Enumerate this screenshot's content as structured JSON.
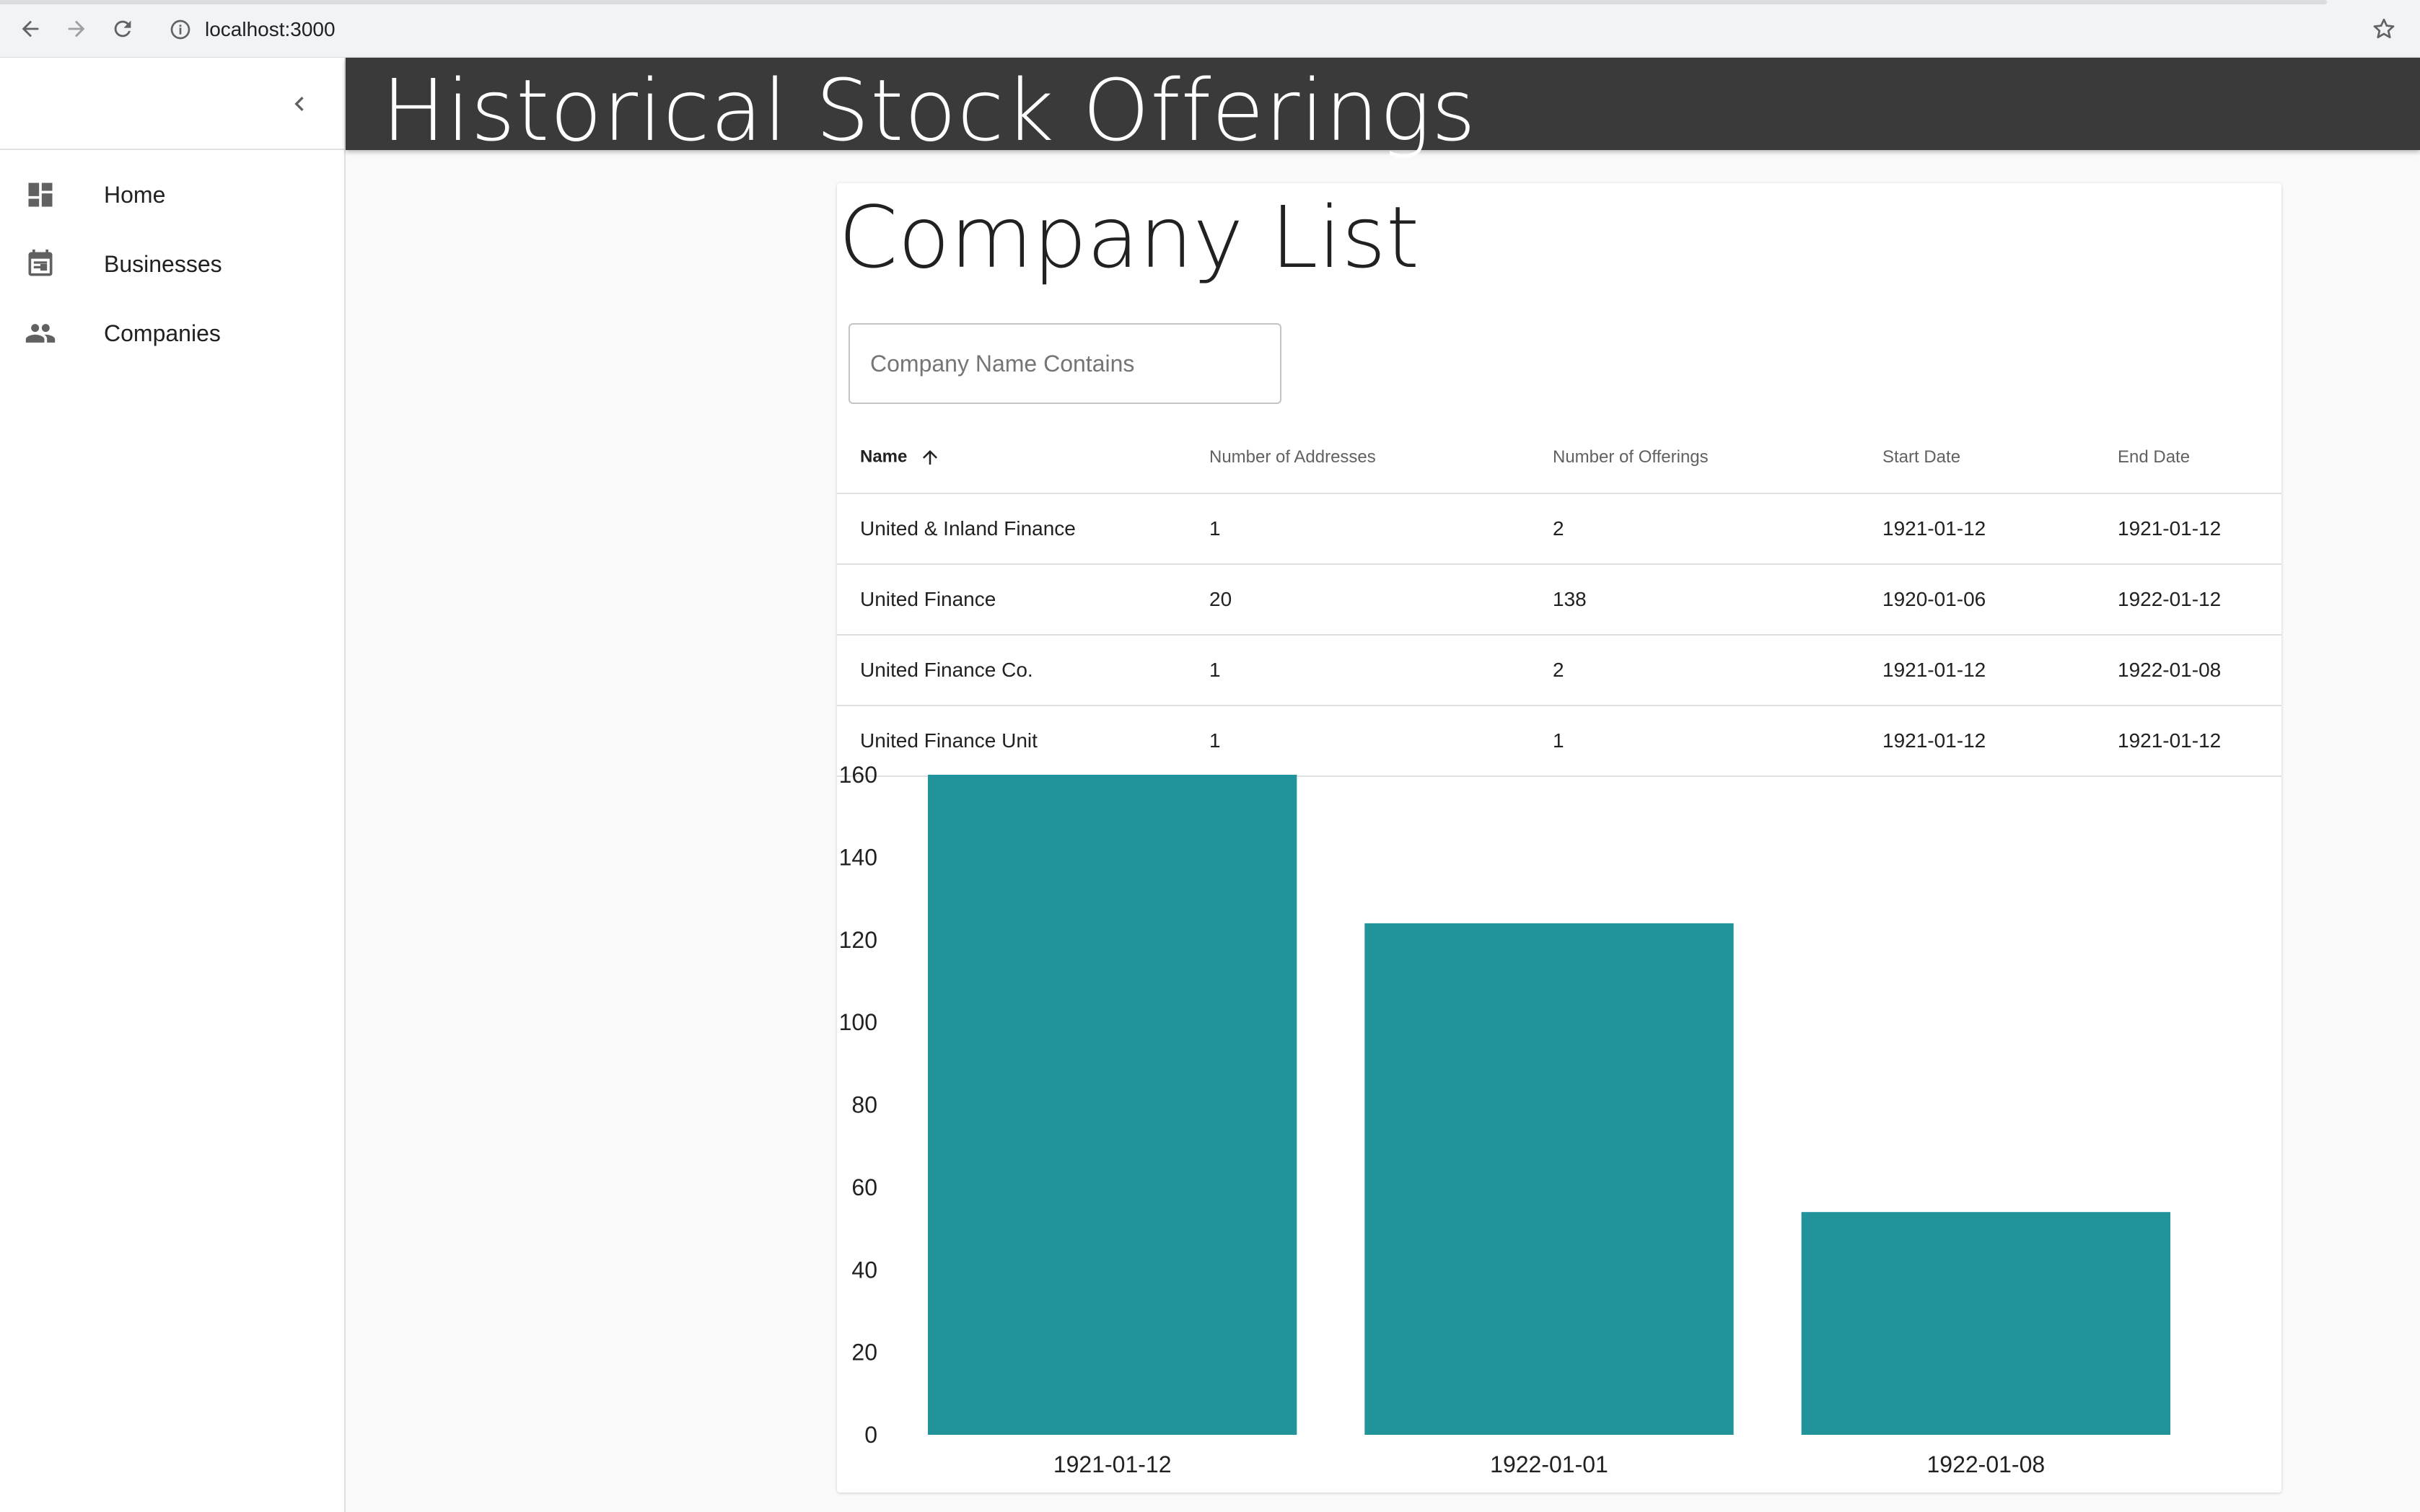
{
  "browser": {
    "url": "localhost:3000",
    "icons": [
      "back-icon",
      "forward-icon",
      "reload-icon",
      "info-icon",
      "star-icon"
    ]
  },
  "sidebar": {
    "items": [
      {
        "label": "Home",
        "icon": "dashboard-icon"
      },
      {
        "label": "Businesses",
        "icon": "calendar-icon"
      },
      {
        "label": "Companies",
        "icon": "people-icon"
      }
    ]
  },
  "header": {
    "title": "Historical Stock Offerings"
  },
  "main": {
    "title": "Company List",
    "search": {
      "placeholder": "Company Name Contains",
      "value": ""
    },
    "table": {
      "sorted_column": "Name",
      "sort_direction": "ascending",
      "columns": [
        "Name",
        "Number of Addresses",
        "Number of Offerings",
        "Start Date",
        "End Date"
      ],
      "rows": [
        [
          "United & Inland Finance",
          "1",
          "2",
          "1921-01-12",
          "1921-01-12"
        ],
        [
          "United Finance",
          "20",
          "138",
          "1920-01-06",
          "1922-01-12"
        ],
        [
          "United Finance Co.",
          "1",
          "2",
          "1921-01-12",
          "1922-01-08"
        ],
        [
          "United Finance Unit",
          "1",
          "1",
          "1921-01-12",
          "1921-01-12"
        ]
      ]
    }
  },
  "chart_data": {
    "type": "bar",
    "categories": [
      "1921-01-12",
      "1922-01-01",
      "1922-01-08"
    ],
    "values": [
      160,
      124,
      54
    ],
    "ylim": [
      0,
      160
    ],
    "yticks": [
      0,
      20,
      40,
      60,
      80,
      100,
      120,
      140,
      160
    ],
    "grid": false,
    "color": "#21949b"
  },
  "colors": {
    "header_bg": "#3a3a3a",
    "bar": "#21949b"
  }
}
